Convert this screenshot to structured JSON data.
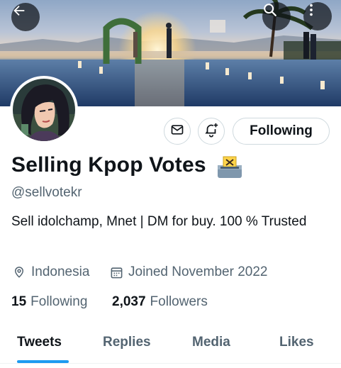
{
  "profile": {
    "display_name": "Selling Kpop Votes",
    "handle": "@sellvotekr",
    "bio": "Sell idolchamp, Mnet | DM for buy. 100 % Trusted",
    "location": "Indonesia",
    "joined": "Joined November 2022"
  },
  "actions": {
    "follow_label": "Following"
  },
  "stats": {
    "following_count": "15",
    "following_label": "Following",
    "followers_count": "2,037",
    "followers_label": "Followers"
  },
  "tabs": [
    {
      "label": "Tweets",
      "active": true
    },
    {
      "label": "Replies",
      "active": false
    },
    {
      "label": "Media",
      "active": false
    },
    {
      "label": "Likes",
      "active": false
    }
  ],
  "icons": {
    "back": "back-arrow-icon",
    "search": "search-icon",
    "more": "more-vertical-icon",
    "message": "envelope-icon",
    "notify": "bell-plus-icon",
    "location": "location-pin-icon",
    "joined": "calendar-icon",
    "ballot": "ballot-box-emoji"
  },
  "colors": {
    "accent": "#1d9bf0",
    "text_primary": "#0f1419",
    "text_secondary": "#536471",
    "border": "#cfd9de"
  }
}
